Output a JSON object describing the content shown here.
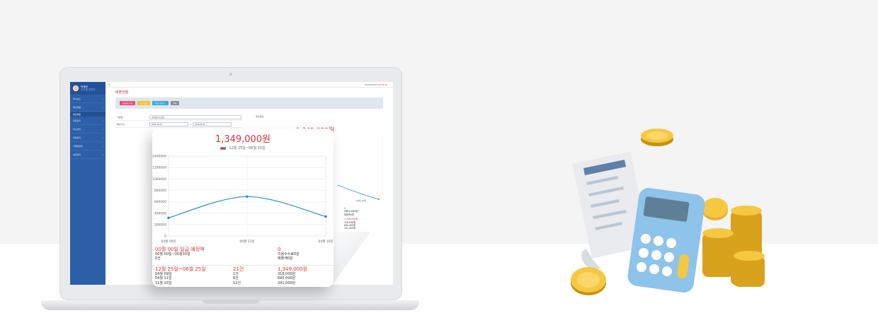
{
  "app": {
    "user_name": "박재현",
    "user_role": "부가세 관리자",
    "topbar_date": "2024.06.25",
    "topbar_time": "10:39:40",
    "page_title": "매출현황",
    "sidebar": {
      "items": [
        {
          "label": "대시보드"
        },
        {
          "label": "매출현황"
        },
        {
          "label": "매출현황"
        },
        {
          "label": "주문관리"
        },
        {
          "label": "재고관리"
        },
        {
          "label": "회원관리"
        },
        {
          "label": "거래처관리"
        },
        {
          "label": "설정관리"
        }
      ]
    },
    "toolbar": {
      "buttons": [
        {
          "label": "일/월/분기/년",
          "color": "#e94d7d"
        },
        {
          "label": "기간 설정",
          "color": "#f2c230"
        },
        {
          "label": "엑셀 다운로드",
          "color": "#3aa9dc"
        },
        {
          "label": "인쇄",
          "color": "#8a8f96"
        }
      ]
    },
    "form": {
      "row1_label": "기준일",
      "row1_value": "결제일자(주문일)",
      "row2_label": "매출기간",
      "row2_from": "2024-12-25",
      "row2_to": "2025-06-25"
    },
    "background": {
      "label": "매출현황",
      "total": "1,349,000원",
      "axis_label": "06월 25일",
      "lines": [
        "0",
        "0",
        "미용수수료0원",
        "매출액0원",
        "1,349,000원",
        "318,000원",
        "690,000원",
        "341,000원"
      ]
    }
  },
  "card": {
    "total": "1,349,000원",
    "legend": "12월 25일~06월 25일",
    "today": {
      "title": "00월 00일 일급 예정액",
      "range": "00월 00일~00월30일",
      "count": "0건",
      "amount": "0",
      "fee": "이용수수료0원",
      "sales": "매출액0원"
    },
    "period": {
      "title": "12월 25일~06월 25일",
      "count": "21건",
      "amount": "1,349,000원",
      "rows": [
        {
          "date": "04월 09일",
          "count": "1건",
          "amount": "318,000원"
        },
        {
          "date": "04월 11일",
          "count": "8건",
          "amount": "690,000원"
        },
        {
          "date": "11월 15일",
          "count": "12건",
          "amount": "341,000원"
        }
      ]
    }
  },
  "chart_data": {
    "type": "line",
    "x": [
      "04월 09일",
      "06월 11일",
      "04월 16일"
    ],
    "series": [
      {
        "values": [
          318000,
          690000,
          341000
        ],
        "color": "#2b8fd0"
      }
    ],
    "yticks": [
      0,
      200000,
      400000,
      600000,
      800000,
      1000000,
      1200000,
      1400000
    ],
    "ylim": [
      0,
      1400000
    ],
    "grid": true,
    "legend": "12월 25일~06월 25일"
  }
}
